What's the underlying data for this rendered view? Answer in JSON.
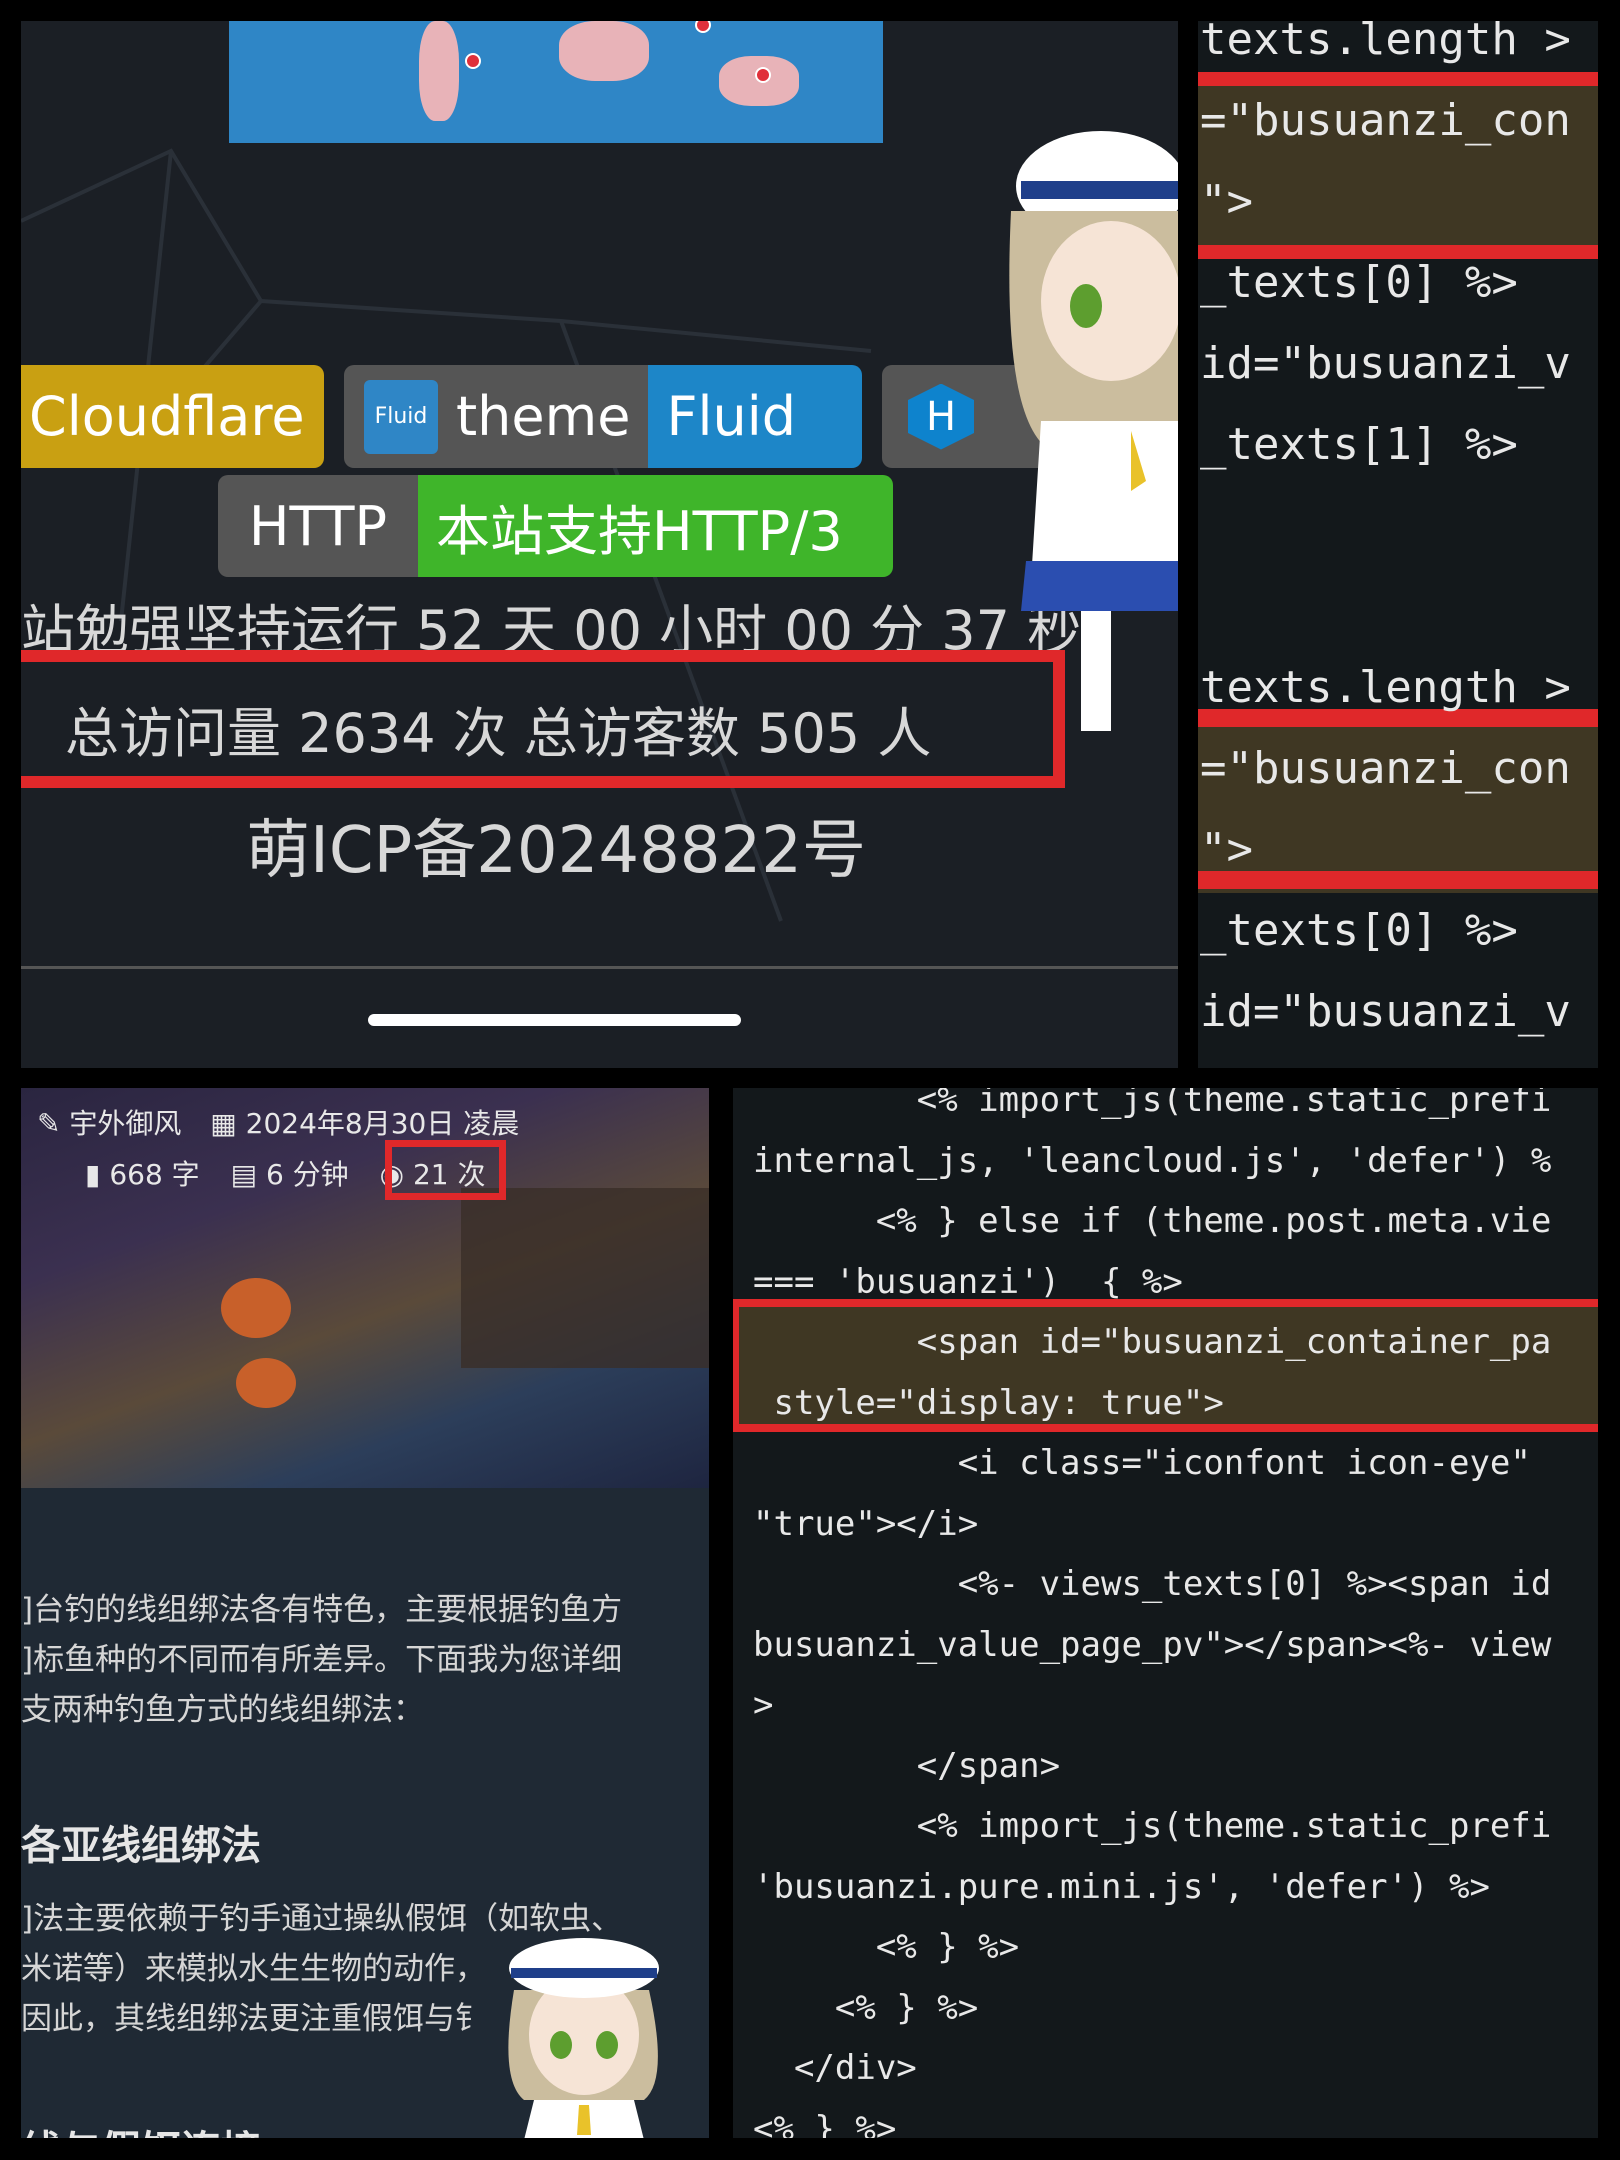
{
  "footer_panel": {
    "badges": [
      {
        "label": "Cloudflare",
        "color": "#c9a012"
      },
      {
        "left": "theme",
        "right": "Fluid",
        "logo": "Fluid",
        "color": "#1d86c8"
      },
      {
        "left": "H",
        "icon": "hexo-hexagon-icon"
      }
    ],
    "http_badge": {
      "left": "HTTP",
      "right": "本站支持HTTP/3",
      "color": "#3fb52a"
    },
    "uptime": "站勉强坚持运行 52 天 00 小时 00 分 37 秒",
    "visits": "总访问量 2634 次  总访客数 505 人",
    "icp": "萌ICP备20248822号",
    "highlight_color": "#e0282a"
  },
  "code_top": {
    "lines": [
      "texts.length >",
      "=\"busuanzi_con",
      "\">",
      "_texts[0] %>",
      "id=\"busuanzi_v",
      "_texts[1] %>",
      "",
      "",
      "texts.length >",
      "=\"busuanzi_con",
      "\">",
      "_texts[0] %>",
      "id=\"busuanzi_v"
    ]
  },
  "post": {
    "author": "宇外御风",
    "date": "2024年8月30日 凌晨",
    "words": "668 字",
    "read_time": "6 分钟",
    "views": "21 次",
    "paragraph1": [
      "]台钓的线组绑法各有特色，主要根据钓鱼方",
      "]标鱼种的不同而有所差异。下面我为您详细",
      "支两种钓鱼方式的线组绑法："
    ],
    "heading": "各亚线组绑法",
    "paragraph2": [
      "]法主要依赖于钓手通过操纵假饵（如软虫、",
      "米诺等）来模拟水生生物的动作，",
      "因此，其线组绑法更注重假饵与钅"
    ],
    "heading2_partial": "线与假饵连接"
  },
  "code_bottom": {
    "lines": [
      "        <% import_js(theme.static_prefi",
      "internal_js, 'leancloud.js', 'defer') %",
      "      <% } else if (theme.post.meta.vie",
      "=== 'busuanzi')  { %>",
      "        <span id=\"busuanzi_container_pa",
      " style=\"display: true\">",
      "          <i class=\"iconfont icon-eye\"",
      "\"true\"></i>",
      "          <%- views_texts[0] %><span id",
      "busuanzi_value_page_pv\"></span><%- view",
      ">",
      "        </span>",
      "        <% import_js(theme.static_prefi",
      "'busuanzi.pure.mini.js', 'defer') %>",
      "      <% } %>",
      "    <% } %>",
      "  </div>",
      "<% } %>"
    ]
  }
}
